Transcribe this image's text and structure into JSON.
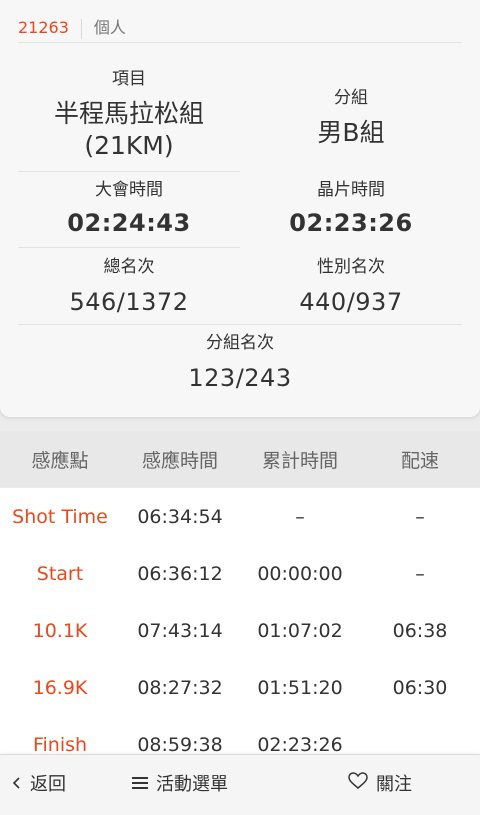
{
  "header": {
    "bib": "21263",
    "category": "個人"
  },
  "summary": {
    "event_label": "項目",
    "event_name_line1": "半程馬拉松組",
    "event_name_line2": "(21KM)",
    "group_label": "分組",
    "group_value": "男B組",
    "gun_time_label": "大會時間",
    "gun_time": "02:24:43",
    "chip_time_label": "晶片時間",
    "chip_time": "02:23:26",
    "overall_rank_label": "總名次",
    "overall_rank": "546/1372",
    "gender_rank_label": "性別名次",
    "gender_rank": "440/937",
    "group_rank_label": "分組名次",
    "group_rank": "123/243"
  },
  "table": {
    "headers": [
      "感應點",
      "感應時間",
      "累計時間",
      "配速"
    ],
    "rows": [
      {
        "point": "Shot Time",
        "time": "06:34:54",
        "elapsed": "–",
        "pace": "–"
      },
      {
        "point": "Start",
        "time": "06:36:12",
        "elapsed": "00:00:00",
        "pace": "–"
      },
      {
        "point": "10.1K",
        "time": "07:43:14",
        "elapsed": "01:07:02",
        "pace": "06:38"
      },
      {
        "point": "16.9K",
        "time": "08:27:32",
        "elapsed": "01:51:20",
        "pace": "06:30"
      },
      {
        "point": "Finish",
        "time": "08:59:38",
        "elapsed": "02:23:26",
        "pace": ""
      }
    ]
  },
  "bottom_bar": {
    "back_label": "返回",
    "menu_label": "活動選單",
    "follow_label": "關注"
  },
  "colors": {
    "accent": "#e8491d",
    "text": "#333333",
    "muted": "#666666"
  }
}
